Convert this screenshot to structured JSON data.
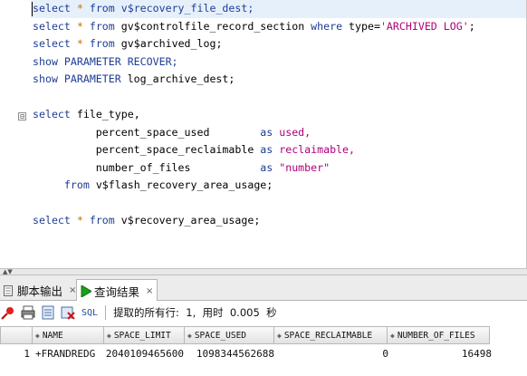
{
  "editor": {
    "lines": [
      [
        {
          "t": "select ",
          "c": "kw"
        },
        {
          "t": "*",
          "c": "star"
        },
        {
          "t": " from v$recovery_file_dest;",
          "c": "kw"
        }
      ],
      [
        {
          "t": "select ",
          "c": "kw"
        },
        {
          "t": "*",
          "c": "star"
        },
        {
          "t": " from ",
          "c": "kw"
        },
        {
          "t": "gv$controlfile_record_section ",
          "c": ""
        },
        {
          "t": "where ",
          "c": "kw"
        },
        {
          "t": "type=",
          "c": ""
        },
        {
          "t": "'ARCHIVED LOG'",
          "c": "str"
        },
        {
          "t": ";",
          "c": ""
        }
      ],
      [
        {
          "t": "select ",
          "c": "kw"
        },
        {
          "t": "*",
          "c": "star"
        },
        {
          "t": " from ",
          "c": "kw"
        },
        {
          "t": "gv$archived_log;",
          "c": ""
        }
      ],
      [
        {
          "t": "show PARAMETER RECOVER;",
          "c": "kw"
        }
      ],
      [
        {
          "t": "show PARAMETER ",
          "c": "kw"
        },
        {
          "t": "log_archive_dest;",
          "c": ""
        }
      ],
      [],
      [
        {
          "t": "select ",
          "c": "kw"
        },
        {
          "t": "file_type,",
          "c": ""
        }
      ],
      [
        {
          "t": "          percent_space_used        ",
          "c": ""
        },
        {
          "t": "as ",
          "c": "kw"
        },
        {
          "t": "used,",
          "c": "str"
        }
      ],
      [
        {
          "t": "          percent_space_reclaimable ",
          "c": ""
        },
        {
          "t": "as ",
          "c": "kw"
        },
        {
          "t": "reclaimable,",
          "c": "str"
        }
      ],
      [
        {
          "t": "          number_of_files           ",
          "c": ""
        },
        {
          "t": "as ",
          "c": "kw"
        },
        {
          "t": "\"number\"",
          "c": "str"
        }
      ],
      [
        {
          "t": "     from ",
          "c": "kw"
        },
        {
          "t": "v$flash_recovery_area_usage;",
          "c": ""
        }
      ],
      [],
      [
        {
          "t": "select ",
          "c": "kw"
        },
        {
          "t": "*",
          "c": "star"
        },
        {
          "t": " from ",
          "c": "kw"
        },
        {
          "t": "v$recovery_area_usage;",
          "c": ""
        }
      ]
    ],
    "fold_marker": "⊟"
  },
  "tabs": {
    "script_output": "脚本输出",
    "query_result": "查询结果",
    "close": "×"
  },
  "toolbar": {
    "sql_label": "SQL",
    "status_text": "提取的所有行:  1,  用时  0.005  秒"
  },
  "grid": {
    "columns": [
      "NAME",
      "SPACE_LIMIT",
      "SPACE_USED",
      "SPACE_RECLAIMABLE",
      "NUMBER_OF_FILES"
    ],
    "rows": [
      {
        "rownum": "1",
        "cells": [
          "+FRANDREDG",
          "2040109465600",
          "1098344562688",
          "0",
          "16498"
        ]
      }
    ]
  },
  "colors": {
    "keyword": "#1e3c96",
    "string": "#b0007a",
    "current_line": "#e6f0fb",
    "run_icon": "#1aa01a"
  }
}
